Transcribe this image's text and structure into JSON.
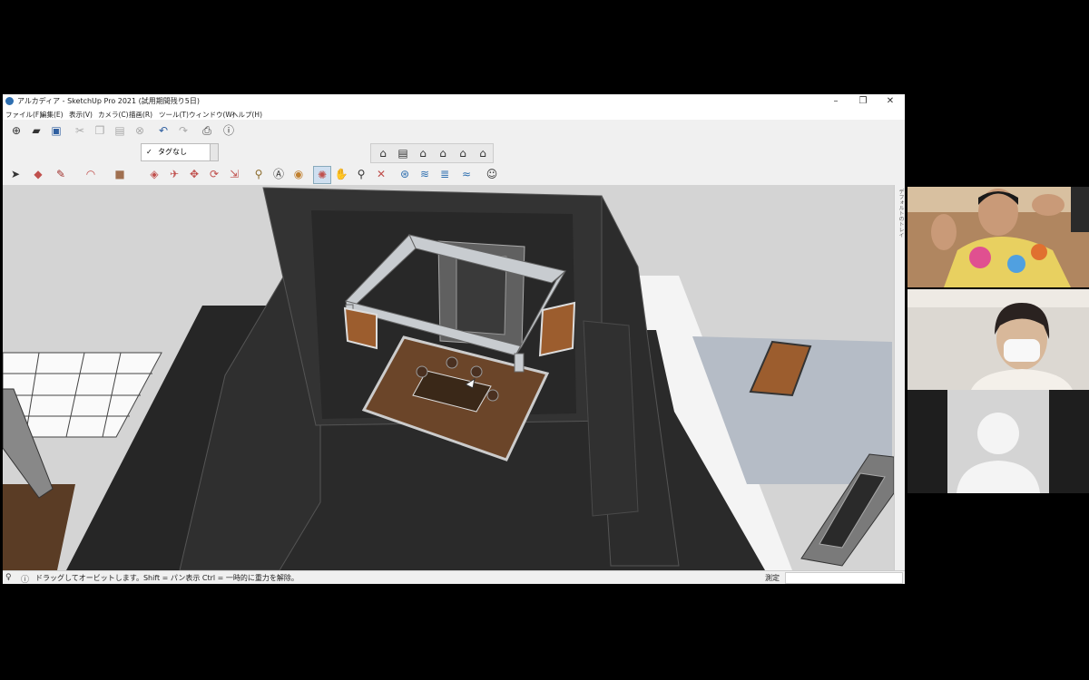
{
  "window": {
    "title": "アルカディア - SketchUp Pro 2021 (試用期間残り5日)",
    "controls": {
      "minimize": "–",
      "maximize": "❐",
      "close": "✕"
    }
  },
  "menu": [
    "ファイル(F)",
    "編集(E)",
    "表示(V)",
    "カメラ(C)",
    "描画(R)",
    "ツール(T)",
    "ウィンドウ(W)",
    "ヘルプ(H)"
  ],
  "tag_selector": {
    "checked": "✓",
    "value": "タグなし"
  },
  "status": {
    "hint": "ドラッグしてオービットします。Shift = パン表示  Ctrl = 一時的に重力を解除。",
    "measure_label": "測定",
    "measure_value": ""
  },
  "right_panel_label": "デフォルトのトレイ",
  "colors": {
    "wall": "#2e2e2e",
    "floor": "#6b4529",
    "door": "#9c5d2e",
    "frame": "#c8ccd0",
    "titlebar": "#ffffff"
  },
  "participants": [
    {
      "name": "participant-1",
      "type": "video"
    },
    {
      "name": "participant-2",
      "type": "video"
    },
    {
      "name": "participant-3",
      "type": "avatar-placeholder"
    }
  ]
}
